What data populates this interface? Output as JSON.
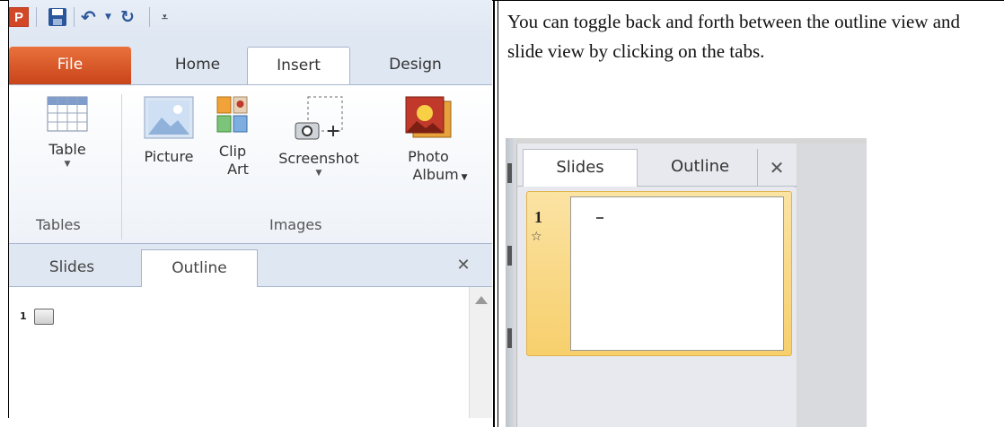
{
  "left": {
    "qat": {
      "app_icon_letter": "P",
      "icons": [
        "powerpoint-app-icon",
        "save-icon",
        "undo-icon",
        "redo-icon",
        "customize-qat-icon"
      ]
    },
    "ribbon_tabs": [
      "File",
      "Home",
      "Insert",
      "Design"
    ],
    "active_tab": "Insert",
    "buttons": {
      "table": {
        "label": "Table"
      },
      "picture": {
        "label": "Picture"
      },
      "clip_art": {
        "label": "Clip",
        "label2": "Art"
      },
      "screenshot": {
        "label": "Screenshot"
      },
      "photo_album": {
        "label": "Photo",
        "label2": "Album"
      }
    },
    "groups": {
      "tables": "Tables",
      "images": "Images"
    },
    "pane_tabs": {
      "slides": "Slides",
      "outline": "Outline"
    },
    "active_pane_tab": "Outline",
    "outline": {
      "slide_number": "1"
    }
  },
  "caption": "You can toggle back and forth between the outline view and slide view by clicking on the tabs.",
  "right": {
    "pane_tabs": {
      "slides": "Slides",
      "outline": "Outline"
    },
    "active_pane_tab": "Slides",
    "thumbnail": {
      "number": "1",
      "star_glyph": "☆"
    }
  },
  "colors": {
    "file_tab": "#d24726",
    "ribbon_bg": "#dfe7f2",
    "selection": "#f7cf6c",
    "accent_blue": "#2b579a"
  }
}
